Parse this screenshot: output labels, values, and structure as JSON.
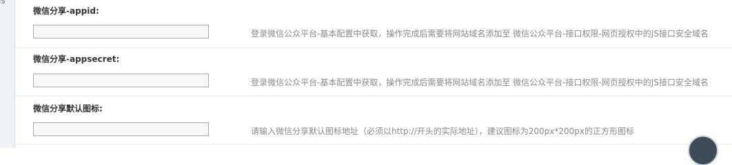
{
  "sidebar": {
    "partial_text": "ls"
  },
  "fields": [
    {
      "label": "微信分享-appid:",
      "value": "",
      "hint": "登录微信公众平台-基本配置中获取，操作完成后需要将网站域名添加至 微信公众平台-接口权限-网页授权中的JS接口安全域名"
    },
    {
      "label": "微信分享-appsecret:",
      "value": "",
      "hint": "登录微信公众平台-基本配置中获取，操作完成后需要将网站域名添加至 微信公众平台-接口权限-网页授权中的JS接口安全域名"
    },
    {
      "label": "微信分享默认图标:",
      "value": "",
      "hint": "请输入微信分享默认图标地址（必须以http://开头的实际地址），建议图标为200px*200px的正方形图标"
    }
  ]
}
